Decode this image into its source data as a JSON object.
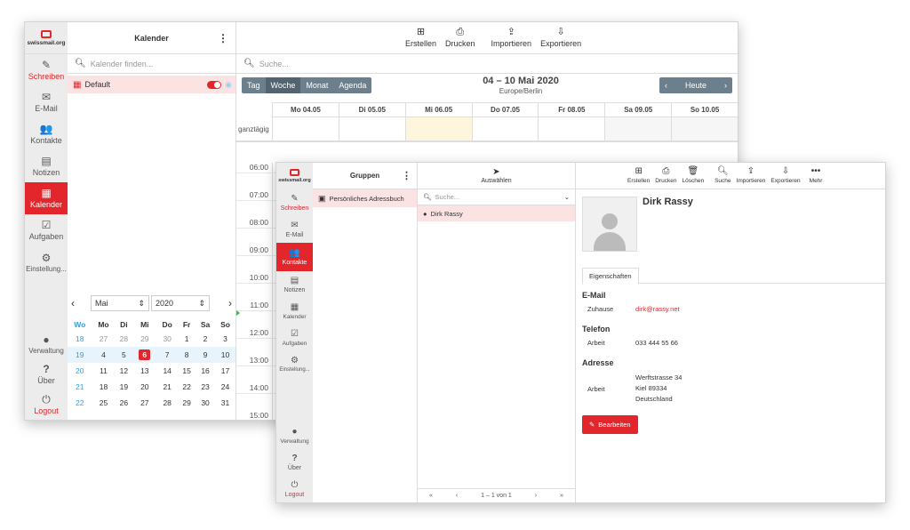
{
  "calendar_window": {
    "logo": "swissmail.org",
    "panel_title": "Kalender",
    "nav": [
      {
        "label": "Schreiben",
        "icon": "compose-icon"
      },
      {
        "label": "E-Mail",
        "icon": "mail-icon"
      },
      {
        "label": "Kontakte",
        "icon": "contacts-icon"
      },
      {
        "label": "Notizen",
        "icon": "notes-icon"
      },
      {
        "label": "Kalender",
        "icon": "calendar-icon"
      },
      {
        "label": "Aufgaben",
        "icon": "tasks-icon"
      },
      {
        "label": "Einstellung...",
        "icon": "settings-icon"
      }
    ],
    "nav_bottom": [
      {
        "label": "Verwaltung",
        "icon": "user-icon"
      },
      {
        "label": "Über",
        "icon": "help-icon"
      },
      {
        "label": "Logout",
        "icon": "power-icon"
      }
    ],
    "search_placeholder": "Kalender finden...",
    "calendars": [
      {
        "name": "Default"
      }
    ],
    "toolbar": {
      "create": "Erstellen",
      "print": "Drucken",
      "import": "Importieren",
      "export": "Exportieren"
    },
    "main_search_placeholder": "Suche...",
    "views": [
      "Tag",
      "Woche",
      "Monat",
      "Agenda"
    ],
    "range_title": "04 – 10 Mai 2020",
    "timezone": "Europe/Berlin",
    "today_label": "Heute",
    "days": [
      "Mo 04.05",
      "Di 05.05",
      "Mi 06.05",
      "Do 07.05",
      "Fr 08.05",
      "Sa 09.05",
      "So 10.05"
    ],
    "allday": "ganztägig",
    "times": [
      "06:00",
      "07:00",
      "08:00",
      "09:00",
      "10:00",
      "11:00",
      "12:00",
      "13:00",
      "14:00",
      "15:00"
    ],
    "mini": {
      "month": "Mai",
      "year": "2020",
      "headers": [
        "Wo",
        "Mo",
        "Di",
        "Mi",
        "Do",
        "Fr",
        "Sa",
        "So"
      ],
      "rows": [
        [
          "18",
          "27",
          "28",
          "29",
          "30",
          "1",
          "2",
          "3"
        ],
        [
          "19",
          "4",
          "5",
          "6",
          "7",
          "8",
          "9",
          "10"
        ],
        [
          "20",
          "11",
          "12",
          "13",
          "14",
          "15",
          "16",
          "17"
        ],
        [
          "21",
          "18",
          "19",
          "20",
          "21",
          "22",
          "23",
          "24"
        ],
        [
          "22",
          "25",
          "26",
          "27",
          "28",
          "29",
          "30",
          "31"
        ]
      ]
    }
  },
  "contacts_window": {
    "logo": "swissmail.org",
    "groups_title": "Gruppen",
    "select_label": "Auswählen",
    "nav": [
      {
        "label": "Schreiben"
      },
      {
        "label": "E-Mail"
      },
      {
        "label": "Kontakte"
      },
      {
        "label": "Notizen"
      },
      {
        "label": "Kalender"
      },
      {
        "label": "Aufgaben"
      },
      {
        "label": "Einstellung..."
      }
    ],
    "nav_bottom": [
      {
        "label": "Verwaltung"
      },
      {
        "label": "Über"
      },
      {
        "label": "Logout"
      }
    ],
    "addressbook": "Persönliches Adressbuch",
    "search_placeholder": "Suche...",
    "contacts": [
      "Dirk Rassy"
    ],
    "pager": "1 – 1 von 1",
    "toolbar": {
      "create": "Erstellen",
      "print": "Drucken",
      "delete": "Löschen",
      "search": "Suche",
      "import": "Importieren",
      "export": "Exportieren",
      "more": "Mehr"
    },
    "detail": {
      "name": "Dirk Rassy",
      "tab": "Eigenschaften",
      "email_h": "E-Mail",
      "email_type": "Zuhause",
      "email": "dirk@rassy.net",
      "phone_h": "Telefon",
      "phone_type": "Arbeit",
      "phone": "033 444 55 66",
      "addr_h": "Adresse",
      "addr_type": "Arbeit",
      "street": "Werftstrasse 34",
      "city": "Kiel 89334",
      "country": "Deutschland",
      "edit": "Bearbeiten"
    }
  }
}
